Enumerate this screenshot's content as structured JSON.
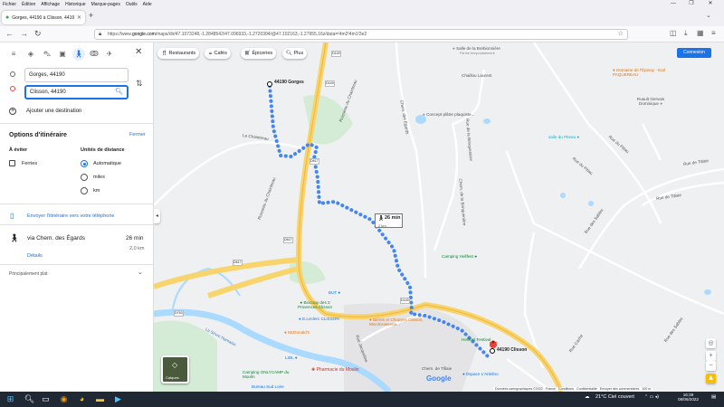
{
  "browser": {
    "menu": [
      "Fichier",
      "Édition",
      "Affichage",
      "Historique",
      "Marque-pages",
      "Outils",
      "Aide"
    ],
    "tab_title": "Gorges, 44190 à Clisson, 44190 - Go",
    "url_prefix": "https://www.",
    "url_host": "google.com",
    "url_rest": "/maps/dir/47.1073248,-1.2848542/47.096933,-1.2720304/@47.102163,-1.27955,16z/data=!4m2!4m1!3e2"
  },
  "panel": {
    "origin": "Gorges, 44190",
    "destination": "Clisson, 44190",
    "add_destination": "Ajouter une destination",
    "options_title": "Options d'itinéraire",
    "close_options": "Fermer",
    "avoid_label": "À éviter",
    "avoid_ferries": "Ferries",
    "units_label": "Unités de distance",
    "units_options": [
      "Automatique",
      "miles",
      "km"
    ],
    "units_selected": "Automatique",
    "send_to_phone": "Envoyer l'itinéraire vers votre téléphone",
    "route": {
      "via": "via Chem. des Égards",
      "duration": "26 min",
      "distance": "2,0 km",
      "details": "Détails"
    },
    "main_legs": "Principalement plat"
  },
  "map": {
    "chips": [
      "Restaurants",
      "Cafés",
      "Épiceries",
      "Plus"
    ],
    "login": "Connexion",
    "origin_label": "44190 Gorges",
    "destination_label": "44190 Clisson",
    "route_duration": "26 min",
    "route_distance": "2 km",
    "layers_label": "Calques",
    "google_logo": "Google",
    "road_labels": [
      "Ruisseau du Chaintreau",
      "Ruisseau du Chaintreau",
      "Chem. des Égards",
      "Rue du Pitiau",
      "Rue du Pitiau",
      "Rue des Sables",
      "Rue des Sables",
      "Rue de Tifiaie",
      "Rue de Tifiaie",
      "La Sèvre Nantaise",
      "Rue Jacqueline",
      "Rue Cache",
      "Chem. de la Brinquenière",
      "Le Chaintreau",
      "Rue de la Brinquenière"
    ],
    "road_numbers": [
      "D149",
      "D149",
      "D617",
      "D617",
      "D617",
      "D763",
      "D149"
    ],
    "pois": [
      "Salle de la Brebionnière",
      "Ferme temporairement",
      "Chaillou Laurent",
      "Concept plâtre plaquiste...",
      "Domaine de l'Épinay - Earl PAQUEREAU",
      "Ruault Gervais Dominique",
      "salle du Piteau",
      "Camping Hellfest",
      "Biocoop des 3 Provences Clisson",
      "BUT",
      "E.Leclerc CLISSON",
      "McDonald's",
      "Bières et Choppes Clisson, Microbrasserie...",
      "LIDL",
      "Pharmacie du Moulin",
      "Camping ONLYCAMP du Moulin",
      "Bureau Sud Loire",
      "Hellfest Festival",
      "Espace L'Artelino",
      "Chem. de Tifiaie"
    ],
    "footer": [
      "Données cartographiques ©2022",
      "France",
      "Conditions",
      "Confidentialité",
      "Envoyer des commentaires",
      "100 m"
    ]
  },
  "taskbar": {
    "weather": "21°C Ciel couvert",
    "time": "16:39",
    "date": "08/06/2022"
  },
  "colors": {
    "route_dots": "#4285f4",
    "accent": "#1a73e8",
    "road_major": "#f8d46d",
    "river": "#aadaff"
  }
}
